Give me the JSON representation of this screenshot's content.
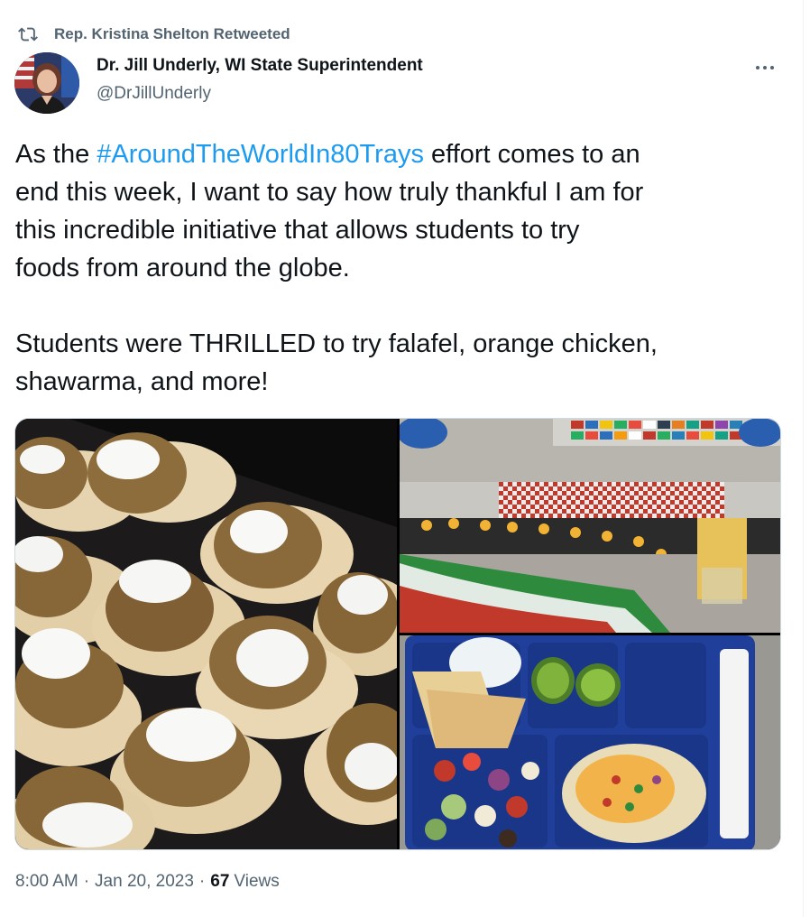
{
  "retweet": {
    "icon": "retweet-icon",
    "label": "Rep. Kristina Shelton Retweeted"
  },
  "author": {
    "name": "Dr. Jill Underly, WI State Superintendent",
    "handle": "@DrJillUnderly",
    "avatar_icon": "avatar"
  },
  "tweet": {
    "line1_before": "As the ",
    "hashtag": "#AroundTheWorldIn80Trays",
    "line1_after": " effort comes to an",
    "line2": "end this week, I want to say how truly thankful I am for",
    "line3": "this incredible initiative that allows students to try",
    "line4": "foods from around the globe.",
    "line5": "Students were THRILLED to try falafel, orange chicken,",
    "line6": "shawarma, and more!"
  },
  "meta": {
    "time": "8:00 AM",
    "separator": "·",
    "date": "Jan 20, 2023",
    "views_count": "67",
    "views_label": "Views"
  },
  "colors": {
    "text": "#0f1419",
    "secondary": "#536471",
    "link": "#1d9bf0",
    "border": "#cfd9de"
  }
}
